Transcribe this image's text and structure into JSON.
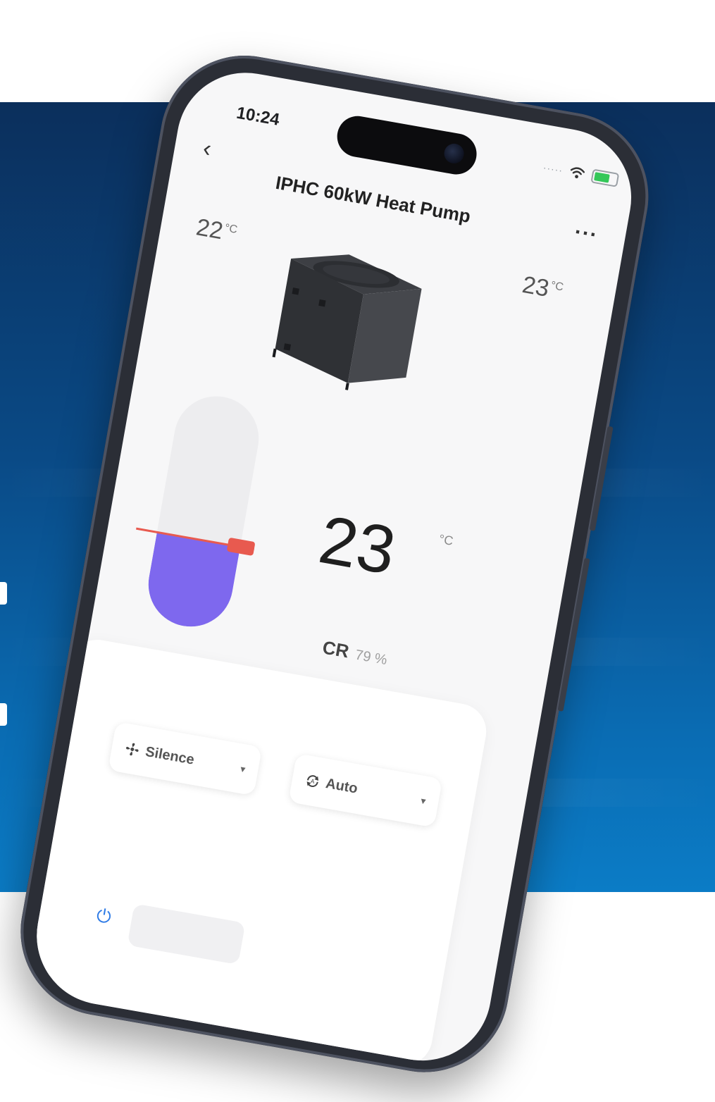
{
  "status_bar": {
    "time": "10:24",
    "signal_text": "·····"
  },
  "header": {
    "back_glyph": "‹",
    "title": "IPHC 60kW Heat Pump",
    "more_glyph": "···"
  },
  "temps": {
    "inlet_value": "22",
    "outlet_value": "23",
    "unit": "°C"
  },
  "setpoint": {
    "value": "23",
    "unit": "°C",
    "slider_level_fraction": 0.38,
    "slider_color": "#7e68ee",
    "marker_color": "#e85a4f"
  },
  "capacity": {
    "label": "CR",
    "value": "79 %"
  },
  "controls": {
    "fan_mode": "Silence",
    "run_mode": "Auto"
  },
  "icons": {
    "back": "chevron-left-icon",
    "more": "more-icon",
    "wifi": "wifi-icon",
    "battery": "battery-icon",
    "fan": "fan-icon",
    "auto": "auto-mode-icon",
    "power": "power-icon"
  },
  "colors": {
    "backdrop_top": "#0b2f5c",
    "backdrop_bottom": "#0b7cc6",
    "power_accent": "#2e7be6",
    "battery_fill": "#34c759"
  }
}
